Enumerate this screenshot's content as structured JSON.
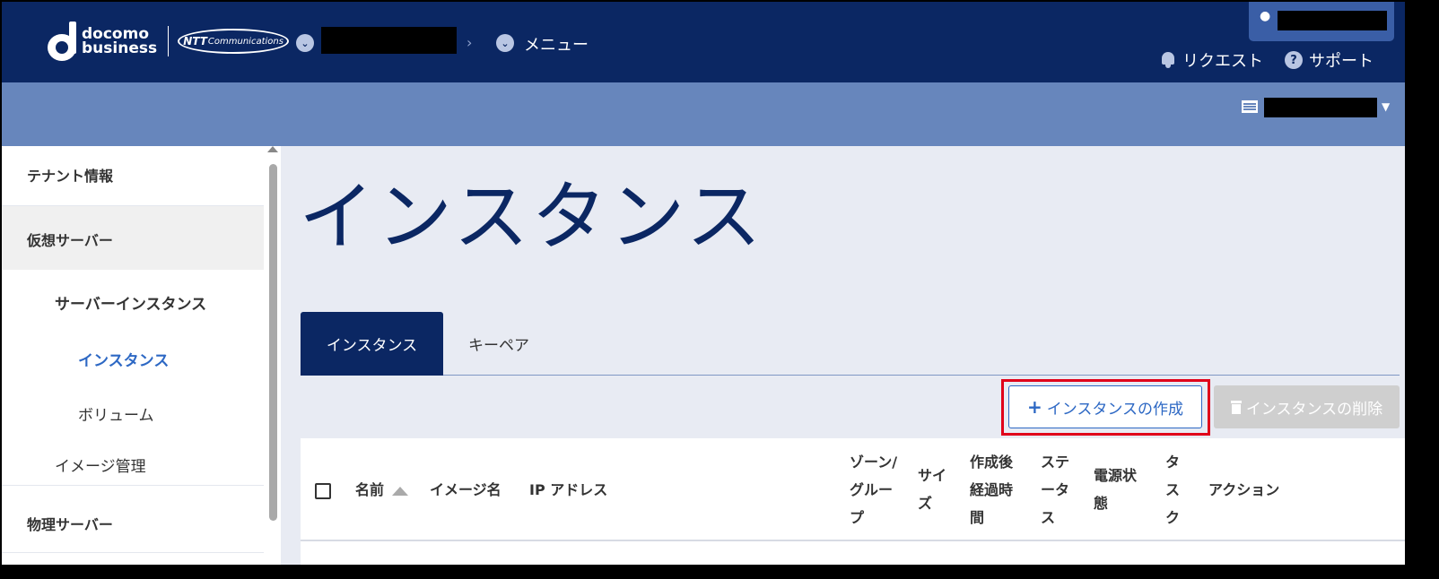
{
  "header": {
    "logo_line1": "docomo",
    "logo_line2": "business",
    "logo_partner": "Communications",
    "logo_partner_mark": "NTT",
    "breadcrumb_menu": "メニュー",
    "request_label": "リクエスト",
    "support_label": "サポート"
  },
  "sidebar": {
    "tenant": "テナント情報",
    "virtual_server": "仮想サーバー",
    "server_instance": "サーバーインスタンス",
    "instance": "インスタンス",
    "volume": "ボリューム",
    "image_mgmt": "イメージ管理",
    "physical_server": "物理サーバー"
  },
  "main": {
    "title": "インスタンス",
    "tabs": [
      "インスタンス",
      "キーペア"
    ],
    "create_button": "インスタンスの作成",
    "delete_button": "インスタンスの削除"
  },
  "table": {
    "columns": [
      "名前",
      "イメージ名",
      "IP アドレス",
      "ゾーン/グループ",
      "サイズ",
      "作成後経過時間",
      "ステータス",
      "電源状態",
      "タスク",
      "アクション"
    ],
    "sort_column": "名前",
    "sort_direction": "ascending"
  },
  "colors": {
    "header_bg": "#0b2763",
    "subbar_bg": "#6786bc",
    "accent": "#2d68c4",
    "highlight": "#e0001a"
  },
  "icons": {
    "breadcrumb": "chevron-circle-down-icon",
    "request": "bell-icon",
    "support": "question-circle-icon",
    "user": "user-icon",
    "project": "list-icon",
    "create": "plus-icon",
    "delete": "trash-icon"
  }
}
